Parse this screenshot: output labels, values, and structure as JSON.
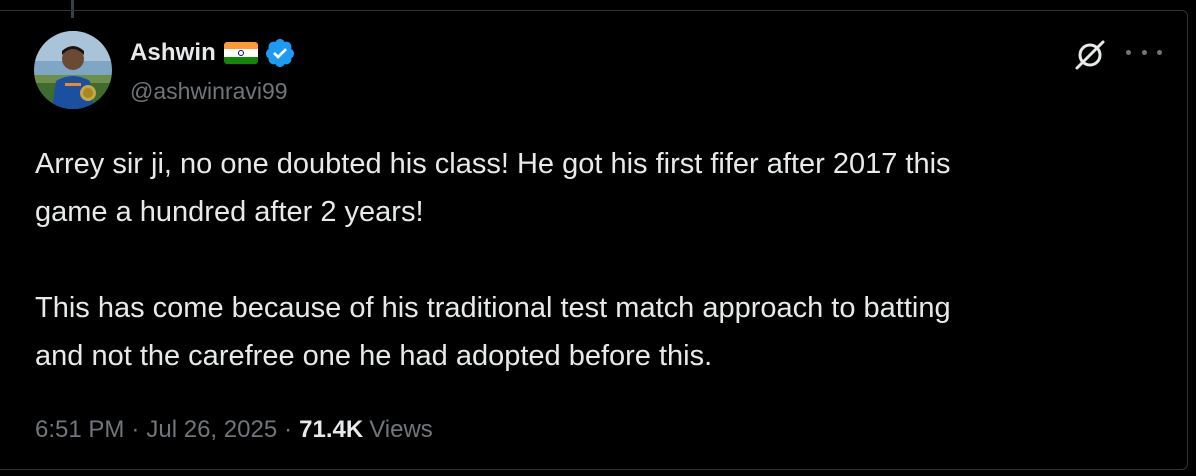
{
  "tweet": {
    "author": {
      "display_name": "Ashwin",
      "handle": "@ashwinravi99",
      "flag_icon": "india-flag-icon",
      "verified_icon": "verified-badge-icon"
    },
    "paragraphs": [
      [
        "Arrey sir ji, no one doubted his class! He got his first fifer after 2017 this",
        "game a hundred after 2 years!"
      ],
      [
        "This has come because of his traditional test match approach to batting",
        "and not the carefree one he had adopted before this."
      ]
    ],
    "meta": {
      "time": "6:51 PM",
      "separator": "·",
      "date": "Jul 26, 2025",
      "views_count": "71.4K",
      "views_label": "Views"
    },
    "actions": {
      "grok_icon": "grok-icon",
      "more_icon": "more-options-icon"
    }
  },
  "colors": {
    "background": "#000000",
    "primary_text": "#e7e9ea",
    "secondary_text": "#71767b",
    "verified_blue": "#1d9bf0",
    "flag_saffron": "#ff9933",
    "flag_white": "#ffffff",
    "flag_green": "#138808",
    "flag_chakra": "#06038d"
  }
}
